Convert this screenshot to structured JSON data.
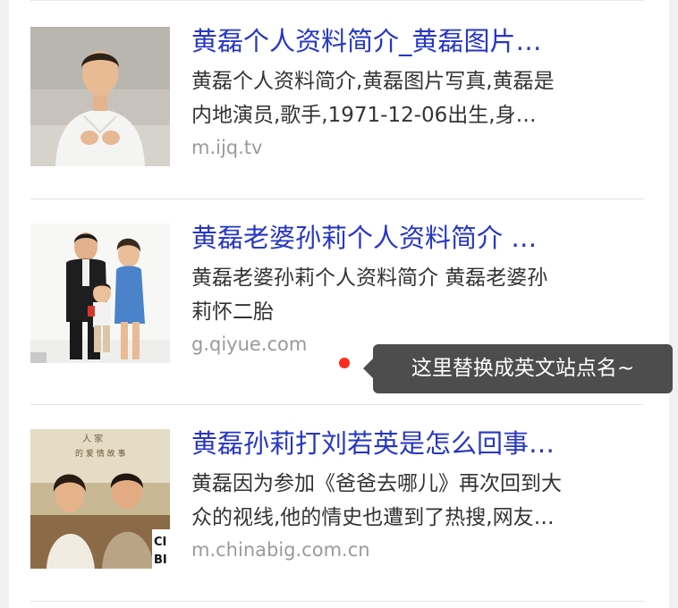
{
  "results": [
    {
      "title": "黄磊个人资料简介_黄磊图片…",
      "desc_lines": [
        "黄磊个人资料简介,黄磊图片写真,黄磊是",
        "内地演员,歌手,1971-12-06出生,身…"
      ],
      "domain": "m.ijq.tv",
      "thumb_icon": "portrait-photo"
    },
    {
      "title": "黄磊老婆孙莉个人资料简介 …",
      "desc_lines": [
        "黄磊老婆孙莉个人资料简介 黄磊老婆孙",
        "莉怀二胎"
      ],
      "domain": "g.qiyue.com",
      "thumb_icon": "family-photo"
    },
    {
      "title": "黄磊孙莉打刘若英是怎么回事…",
      "desc_lines": [
        "黄磊因为参加《爸爸去哪儿》再次回到大",
        "众的视线,他的情史也遭到了热搜,网友…"
      ],
      "domain": "m.chinabig.com.cn",
      "thumb_icon": "movie-still-photo"
    }
  ],
  "tooltip": {
    "text": "这里替换成英文站点名~",
    "marker_color": "#ff2a1e"
  },
  "colors": {
    "title": "#2636c4",
    "desc": "#333333",
    "domain": "#9a9a9a",
    "tooltip_bg": "#4d4d4d"
  }
}
